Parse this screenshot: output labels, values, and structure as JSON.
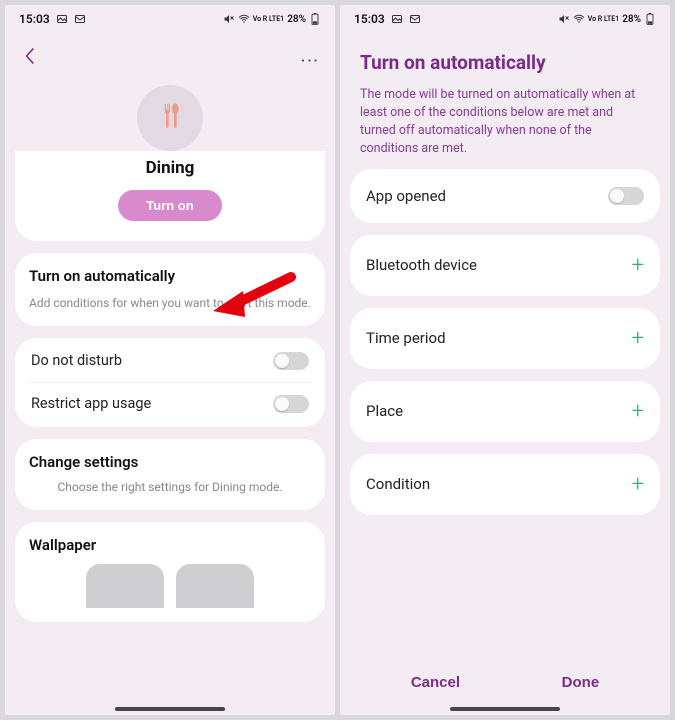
{
  "status": {
    "time": "15:03",
    "battery": "28%",
    "net": "Vo R LTE1"
  },
  "left": {
    "mode_name": "Dining",
    "turn_on": "Turn on",
    "auto": {
      "title": "Turn on automatically",
      "sub": "Add conditions for when you want to start this mode."
    },
    "dnd": "Do not disturb",
    "restrict": "Restrict app usage",
    "settings": {
      "title": "Change settings",
      "sub": "Choose the right settings for Dining mode."
    },
    "wallpaper": "Wallpaper"
  },
  "right": {
    "title": "Turn on automatically",
    "desc": "The mode will be turned on automatically when at least one of the conditions below are met and turned off automatically when none of the conditions are met.",
    "rows": {
      "app_opened": "App opened",
      "bluetooth": "Bluetooth device",
      "time": "Time period",
      "place": "Place",
      "condition": "Condition"
    },
    "cancel": "Cancel",
    "done": "Done"
  }
}
